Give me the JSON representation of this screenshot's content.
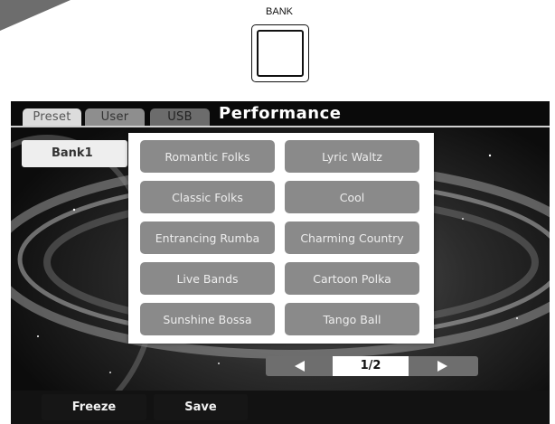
{
  "panel": {
    "bank_label": "BANK"
  },
  "screen": {
    "tabs": [
      {
        "label": "Preset"
      },
      {
        "label": "User"
      },
      {
        "label": "USB"
      }
    ],
    "title": "Performance",
    "bank": "Bank1",
    "styles": [
      "Romantic Folks",
      "Lyric Waltz",
      "Classic Folks",
      "Cool",
      "Entrancing Rumba",
      "Charming Country",
      "Live Bands",
      "Cartoon Polka",
      "Sunshine Bossa",
      "Tango Ball"
    ],
    "page": "1/2",
    "buttons": {
      "freeze": "Freeze",
      "save": "Save"
    }
  }
}
